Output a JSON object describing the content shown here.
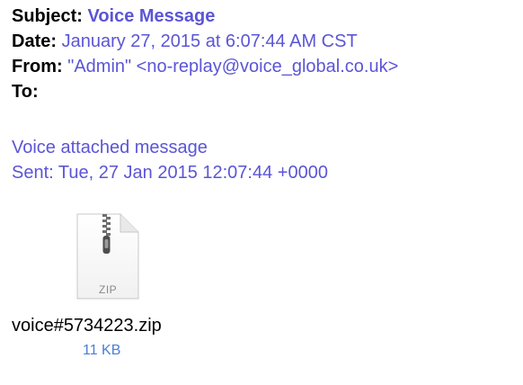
{
  "email": {
    "subject_label": "Subject:",
    "subject": "Voice Message",
    "date_label": "Date:",
    "date": "January 27, 2015 at 6:07:44 AM CST",
    "from_label": "From:",
    "from": "\"Admin\" <no-replay@voice_global.co.uk>",
    "to_label": "To:",
    "to": ""
  },
  "body": {
    "line1": "Voice attached message",
    "line2": "Sent: Tue, 27 Jan 2015 12:07:44 +0000"
  },
  "attachment": {
    "icon": "zip-file-icon",
    "icon_label": "ZIP",
    "filename": "voice#5734223.zip",
    "size": "11 KB"
  },
  "colors": {
    "header_value": "#5b55d6",
    "file_size": "#4a7ed6"
  }
}
